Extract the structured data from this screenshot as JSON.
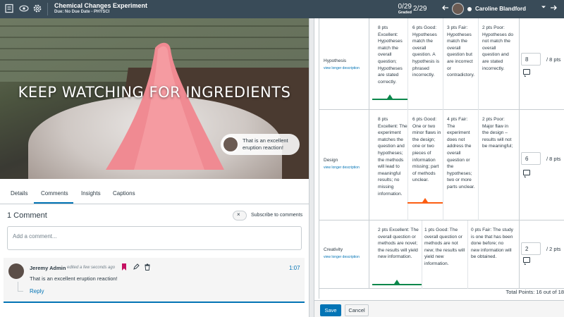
{
  "toolbar": {
    "icons": [
      "gradebook-icon",
      "eye-icon",
      "gear-icon"
    ],
    "assignment_title": "Chemical Changes Experiment",
    "due_line": "Due: No Due Date - PHYSCI",
    "graded_count": "0/29",
    "graded_label": "Graded",
    "position": "2/29",
    "student_name": "Caroline Blandford"
  },
  "media": {
    "overlay_text": "KEEP WATCHING FOR INGREDIENTS",
    "bubble_text": "That is an excellent eruption reaction!"
  },
  "tabs": [
    {
      "label": "Details"
    },
    {
      "label": "Comments"
    },
    {
      "label": "Insights"
    },
    {
      "label": "Captions"
    }
  ],
  "comments": {
    "count_label": "1 Comment",
    "subscribe_label": "Subscribe to comments",
    "subscribe_toggle_glyph": "×",
    "add_placeholder": "Add a comment...",
    "items": [
      {
        "author": "Jeremy Admin",
        "meta": "edited a few seconds ago",
        "time": "1:07",
        "text": "That is an excellent eruption reaction!",
        "reply_label": "Reply"
      }
    ]
  },
  "rubric": {
    "link_label": "view longer description",
    "criteria": [
      {
        "name": "Hypothesis",
        "ratings": [
          "8 pts Excellent: Hypotheses match the overall question; Hypotheses are stated correctly.",
          "6 pts Good: Hypotheses match the overall question. A hypothesis is phrased incorrectly.",
          "3 pts Fair: Hypotheses match the overall question but are incorrect or contradictory.",
          "2 pts Poor: Hypotheses do not match the overall question and are stated incorrectly."
        ],
        "selected_index": 0,
        "selected_color": "#0b874b",
        "score": "8",
        "max": "/ 8 pts"
      },
      {
        "name": "Design",
        "ratings": [
          "8 pts Excellent: The experiment matches the question and hypotheses; the methods will lead to meaningful results; no missing information.",
          "6 pts Good: One or two minor flaws in the design; one or two pieces of information missing; part of methods unclear.",
          "4 pts Fair: The experiment does not address the overall question or the hypotheses; two or more parts unclear.",
          "2 pts Poor: Major flaw in the design – results will not be meaningful;"
        ],
        "selected_index": 1,
        "selected_color": "#fc5e13",
        "score": "6",
        "max": "/ 8 pts"
      },
      {
        "name": "Creativity",
        "ratings": [
          "2 pts Excellent: The overall question or methods are novel; the results will yield new information.",
          "1 pts Good: The overall question or methods are not new; the results will yield new information.",
          "0 pts Fair: The study is one that has been done before; no new information will be obtained."
        ],
        "selected_index": 0,
        "selected_color": "#0b874b",
        "score": "2",
        "max": "/ 2 pts"
      }
    ],
    "total": "Total Points: 16 out of 18"
  },
  "buttons": {
    "save": "Save",
    "cancel": "Cancel"
  }
}
